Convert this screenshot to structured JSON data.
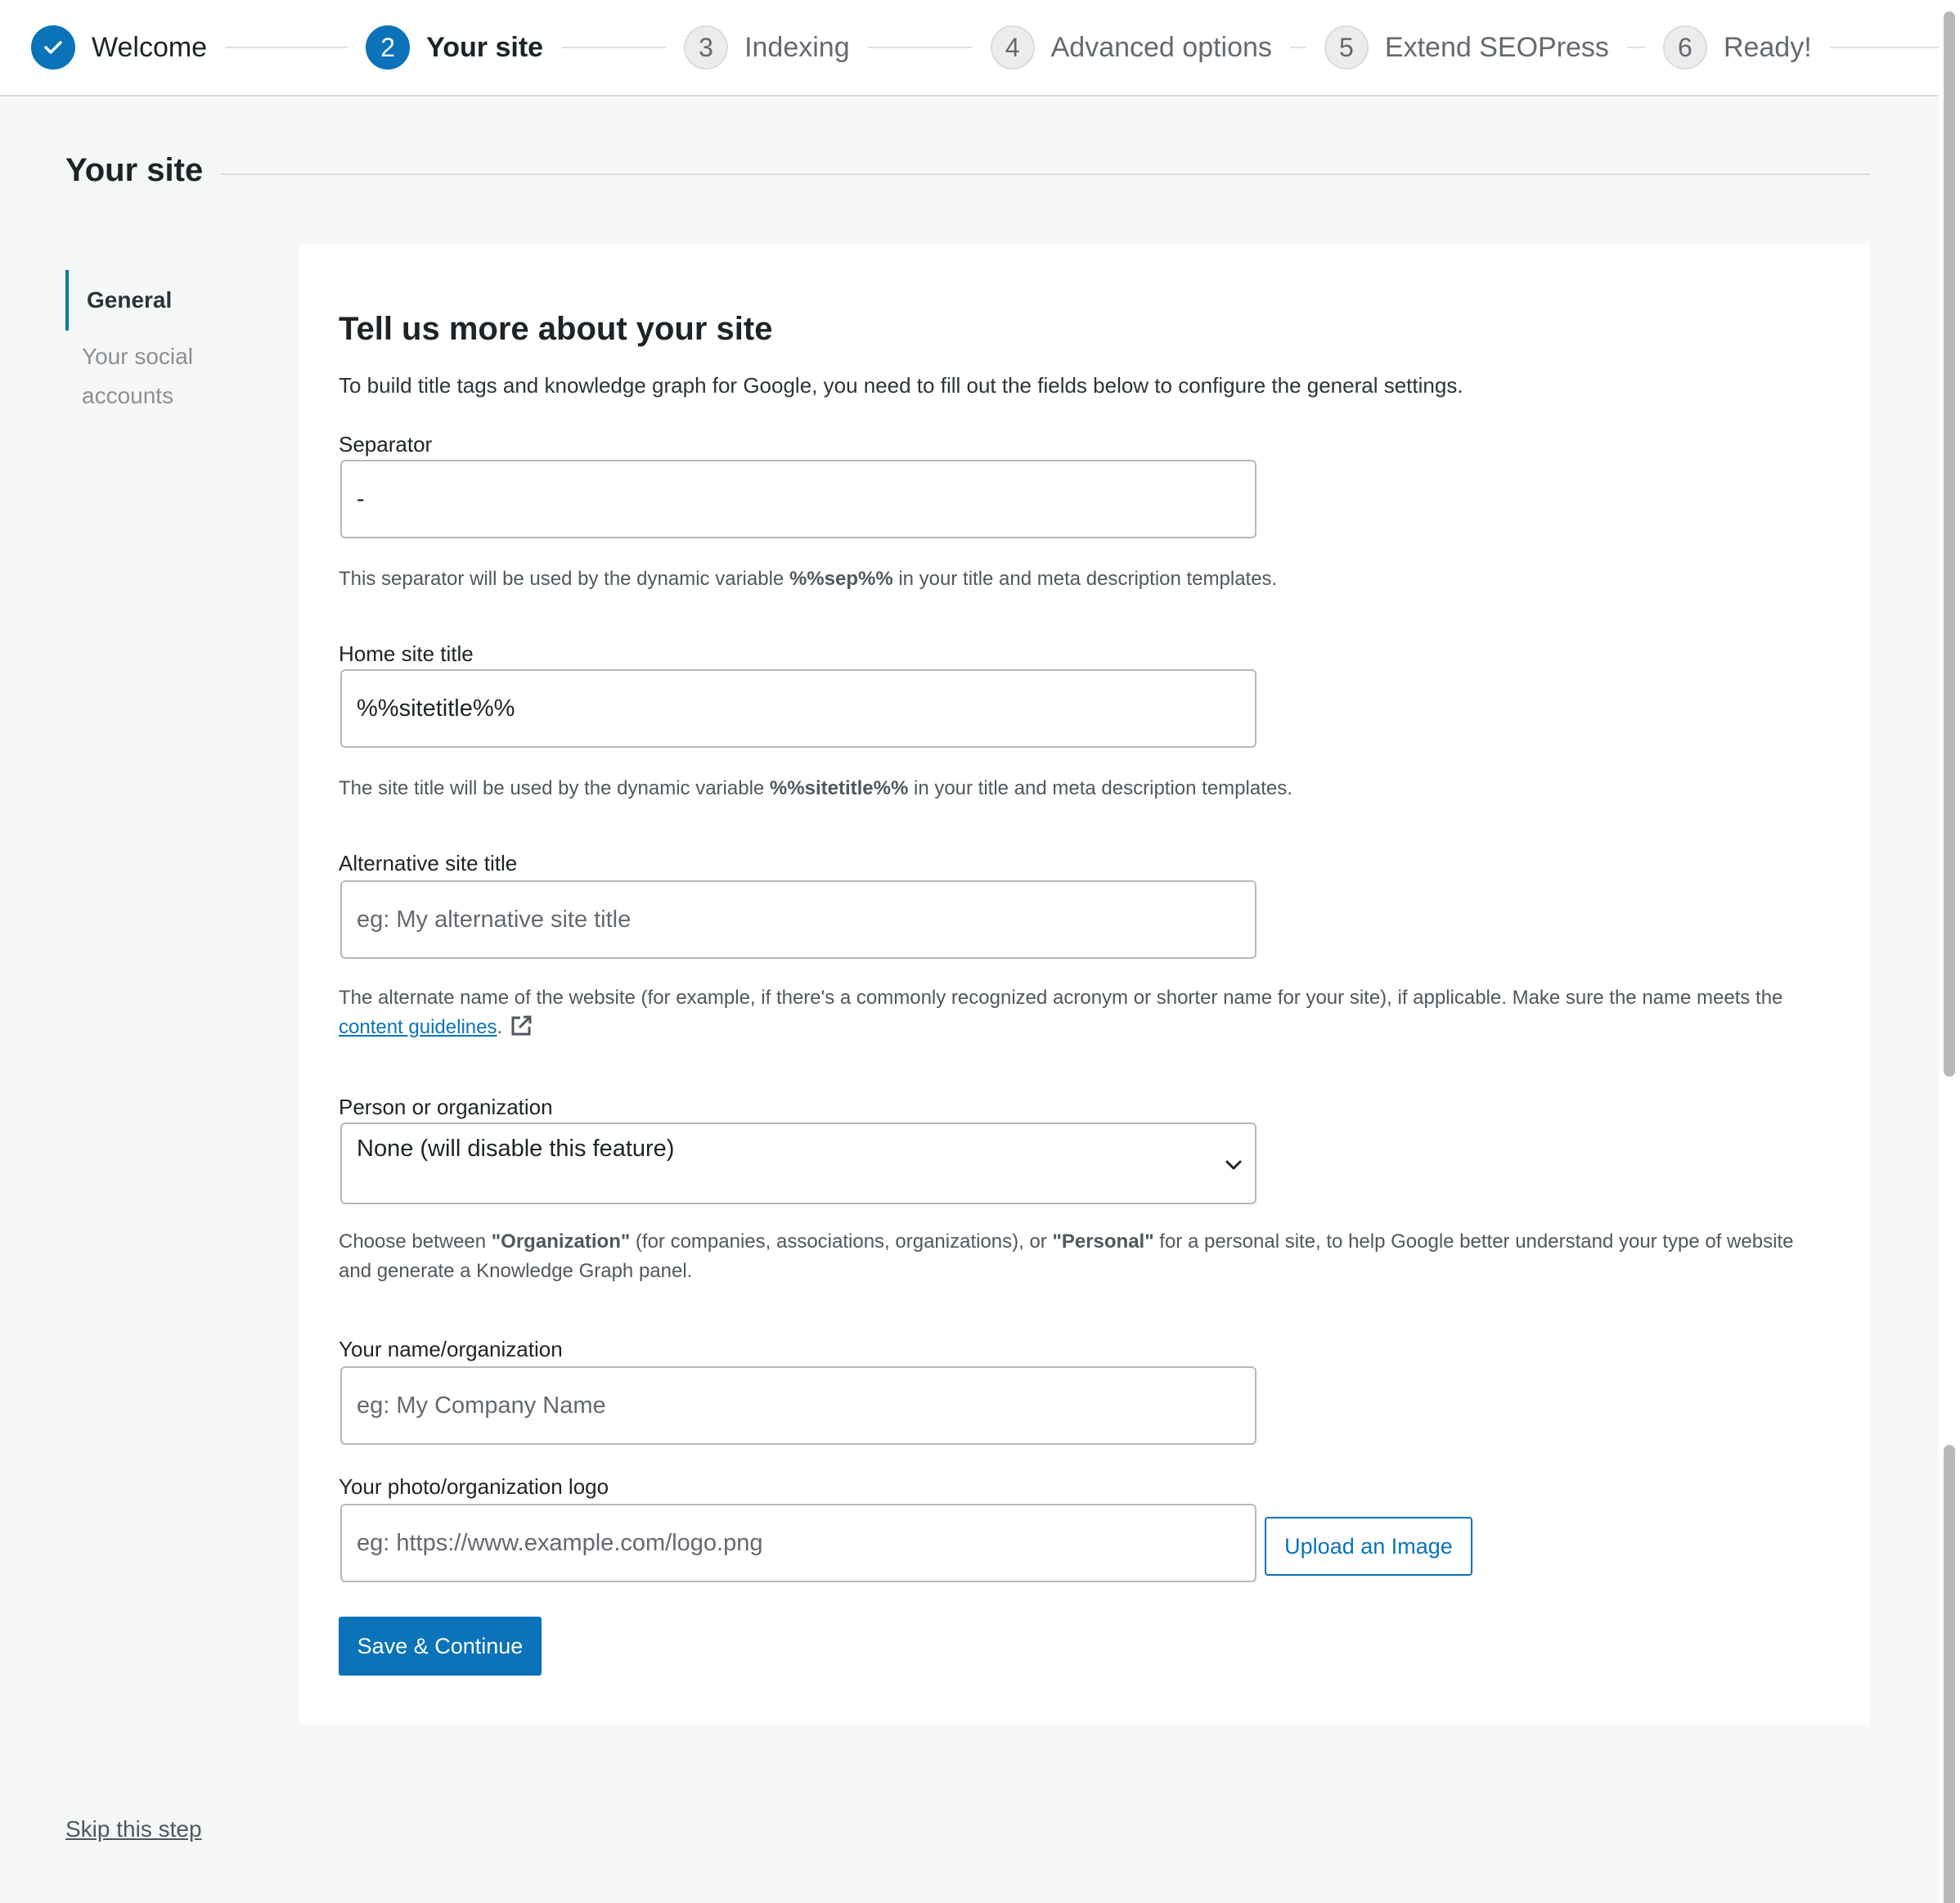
{
  "stepper": {
    "steps": [
      {
        "number": "",
        "label": "Welcome",
        "state": "done"
      },
      {
        "number": "2",
        "label": "Your site",
        "state": "active"
      },
      {
        "number": "3",
        "label": "Indexing",
        "state": "pending"
      },
      {
        "number": "4",
        "label": "Advanced options",
        "state": "pending"
      },
      {
        "number": "5",
        "label": "Extend SEOPress",
        "state": "pending"
      },
      {
        "number": "6",
        "label": "Ready!",
        "state": "pending"
      }
    ]
  },
  "page": {
    "title": "Your site"
  },
  "sidenav": {
    "items": [
      {
        "label": "General",
        "active": true
      },
      {
        "label": "Your social accounts",
        "active": false
      }
    ]
  },
  "card": {
    "heading": "Tell us more about your site",
    "intro": "To build title tags and knowledge graph for Google, you need to fill out the fields below to configure the general settings."
  },
  "fields": {
    "separator": {
      "label": "Separator",
      "value": "-",
      "help_pre": "This separator will be used by the dynamic variable ",
      "help_var": "%%sep%%",
      "help_post": " in your title and meta description templates."
    },
    "home_title": {
      "label": "Home site title",
      "value": "%%sitetitle%%",
      "help_pre": "The site title will be used by the dynamic variable ",
      "help_var": "%%sitetitle%%",
      "help_post": " in your title and meta description templates."
    },
    "alt_title": {
      "label": "Alternative site title",
      "placeholder": "eg: My alternative site title",
      "help_pre": "The alternate name of the website (for example, if there's a commonly recognized acronym or shorter name for your site), if applicable. Make sure the name meets the ",
      "help_link": "content guidelines",
      "help_post": "."
    },
    "person_org": {
      "label": "Person or organization",
      "selected": "None (will disable this feature)",
      "help_1": "Choose between ",
      "help_org": "\"Organization\"",
      "help_2": " (for companies, associations, organizations), or ",
      "help_personal": "\"Personal\"",
      "help_3": " for a personal site, to help Google better understand your type of website and generate a Knowledge Graph panel."
    },
    "name_org": {
      "label": "Your name/organization",
      "placeholder": "eg: My Company Name"
    },
    "logo": {
      "label": "Your photo/organization logo",
      "placeholder": "eg: https://www.example.com/logo.png",
      "upload_label": "Upload an Image"
    }
  },
  "actions": {
    "save_label": "Save & Continue",
    "skip_label": "Skip this step"
  },
  "colors": {
    "accent": "#0a73b9",
    "background": "#f6f7f7"
  }
}
